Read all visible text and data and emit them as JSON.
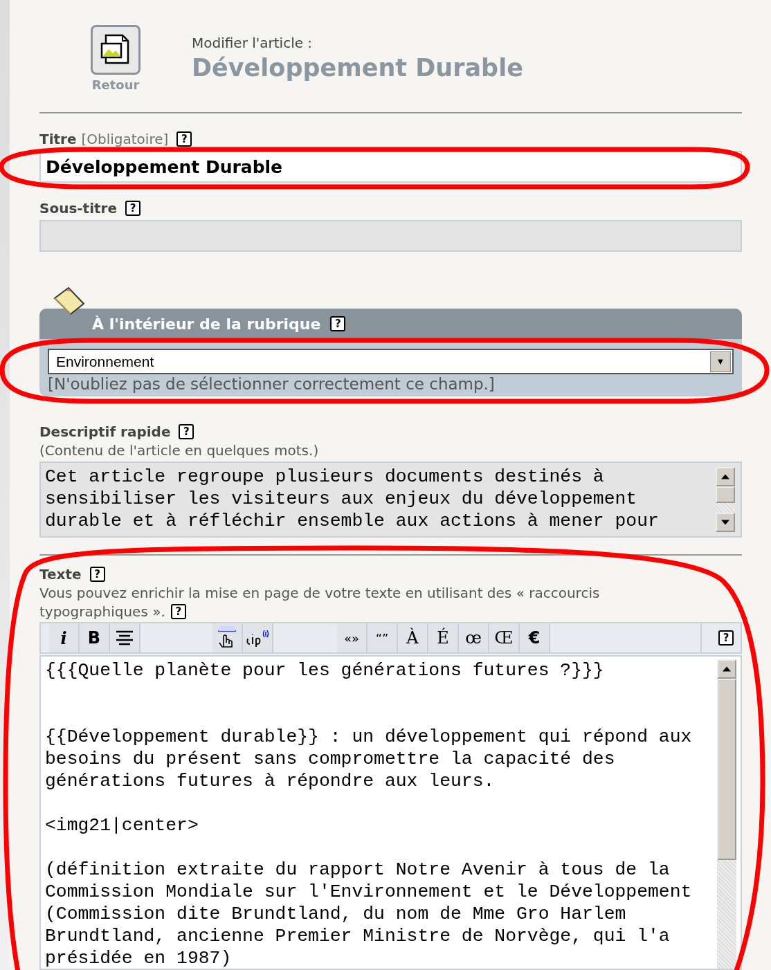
{
  "header": {
    "back_label": "Retour",
    "caption": "Modifier l'article :",
    "title": "Développement Durable"
  },
  "titre": {
    "label": "Titre",
    "note": "[Obligatoire]",
    "help": "?",
    "value": "Développement Durable"
  },
  "sous_titre": {
    "label": "Sous-titre",
    "help": "?"
  },
  "rubrique": {
    "label": "À l'intérieur de la rubrique",
    "help": "?",
    "value": "Environnement",
    "arrow": "▼",
    "note": "[N'oubliez pas de sélectionner correctement ce champ.]"
  },
  "descriptif": {
    "label": "Descriptif rapide",
    "help": "?",
    "hint": "(Contenu de l'article en quelques mots.)",
    "lines": [
      "Cet article regroupe plusieurs documents destinés à",
      "sensibiliser les visiteurs aux enjeux du développement",
      "durable et à réfléchir ensemble aux actions à mener pour"
    ]
  },
  "texte": {
    "label": "Texte",
    "help": "?",
    "hint_lines": [
      "Vous pouvez enrichir la mise en page de votre texte en utilisant des « raccourcis",
      "typographiques »."
    ],
    "hint_help": "?",
    "toolbar": [
      [
        {
          "kind": "italic",
          "label": "i"
        },
        {
          "kind": "bold",
          "label": "B"
        },
        {
          "kind": "align"
        }
      ],
      [
        {
          "kind": "link"
        },
        {
          "kind": "note"
        }
      ],
      [
        {
          "kind": "quote",
          "label": "«»"
        },
        {
          "kind": "quote",
          "label": "“”"
        },
        {
          "kind": "letter",
          "label": "À"
        },
        {
          "kind": "letter",
          "label": "É"
        },
        {
          "kind": "letter",
          "label": "œ"
        },
        {
          "kind": "letter",
          "label": "Œ"
        },
        {
          "kind": "bold",
          "label": "€"
        }
      ]
    ],
    "toolbar_help": "?",
    "paragraphs": [
      {
        "kind": "heading",
        "lines": [
          "{{{Quelle planète pour les générations futures ?}}}"
        ]
      },
      {
        "kind": "body",
        "lines": [
          "{{Développement durable}} : un développement qui répond aux",
          "besoins du présent sans compromettre la capacité des",
          "générations futures à répondre aux leurs."
        ]
      },
      {
        "kind": "body",
        "lines": [
          "<img21|center>"
        ]
      },
      {
        "kind": "body",
        "lines": [
          "(définition extraite du rapport Notre Avenir à tous de la",
          "Commission Mondiale sur l'Environnement et le Développement",
          "(Commission dite Brundtland, du nom de Mme Gro Harlem",
          "Brundtland, ancienne Premier Ministre de Norvège, qui l'a",
          "présidée en 1987)"
        ]
      }
    ]
  }
}
